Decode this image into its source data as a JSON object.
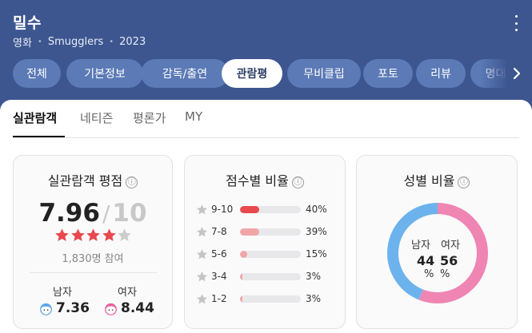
{
  "header": {
    "title": "밀수",
    "meta": [
      "영화",
      "Smugglers",
      "2023"
    ]
  },
  "tabs": [
    "전체",
    "기본정보",
    "감독/출연",
    "관람평",
    "무비클립",
    "포토",
    "리뷰",
    "명대사"
  ],
  "active_tab": "관람평",
  "subtabs": [
    "실관람객",
    "네티즌",
    "평론가",
    "MY"
  ],
  "active_subtab": "실관람객",
  "rating_card": {
    "title": "실관람객 평점",
    "info_icon": "ⓘ",
    "score": "7.96",
    "slash": "/",
    "max": "10",
    "stars_value": 3.98,
    "stars_total": 5,
    "participants": "1,830명 참여",
    "male_label": "남자",
    "male_score": "7.36",
    "female_label": "여자",
    "female_score": "8.44"
  },
  "distribution_card": {
    "title": "점수별 비율",
    "info_icon": "ⓘ",
    "rows": [
      {
        "range": "9-10",
        "percent": 40,
        "label": "40%",
        "color": "#e8484e"
      },
      {
        "range": "7-8",
        "percent": 39,
        "label": "39%",
        "color": "#f0a5a8"
      },
      {
        "range": "5-6",
        "percent": 15,
        "label": "15%",
        "color": "#f0a5a8"
      },
      {
        "range": "3-4",
        "percent": 3,
        "label": "3%",
        "color": "#f0a5a8"
      },
      {
        "range": "1-2",
        "percent": 3,
        "label": "3%",
        "color": "#f0a5a8"
      }
    ]
  },
  "gender_card": {
    "title": "성별 비율",
    "info_icon": "ⓘ",
    "male_label": "남자",
    "female_label": "여자",
    "male_percent": 44,
    "female_percent": 56,
    "male_value": "44",
    "female_value": "56",
    "unit": "%",
    "male_color": "#6cb3ee",
    "female_color": "#ef85b3"
  },
  "colors": {
    "header_bg": "#3d5690",
    "tab_bg": "#5b7ab6",
    "star_red": "#e8484e",
    "star_gray": "#cccccc"
  },
  "icons": {
    "more": "more-vertical-icon",
    "next": "chevron-right-icon",
    "info": "info-icon",
    "star": "star-icon",
    "male": "male-face-icon",
    "female": "female-face-icon"
  }
}
